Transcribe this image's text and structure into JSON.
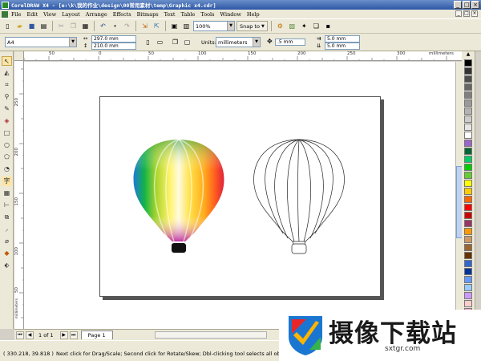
{
  "window": {
    "title": "CorelDRAW X4 - [e:\\k\\我的作业\\design\\00常用素材\\temp\\Graphic x4.cdr]",
    "controls": [
      "_",
      "□",
      "×"
    ]
  },
  "menu": {
    "items": [
      "File",
      "Edit",
      "View",
      "Layout",
      "Arrange",
      "Effects",
      "Bitmaps",
      "Text",
      "Table",
      "Tools",
      "Window",
      "Help"
    ],
    "mdi_controls": [
      "_",
      "□",
      "×"
    ]
  },
  "toolbar": {
    "zoom_value": "100%",
    "snap_label": "Snap to"
  },
  "property_bar": {
    "paper": "A4",
    "width": "297.0 mm",
    "height": "210.0 mm",
    "units_label": "Units:",
    "units_value": "millimeters",
    "nudge": ".5 mm",
    "dup_x": "5.0 mm",
    "dup_y": "5.0 mm"
  },
  "rulers": {
    "h_labels": [
      "100",
      "50",
      "0",
      "50",
      "100",
      "150",
      "200",
      "250",
      "300"
    ],
    "h_unit": "millimeters",
    "v_labels": [
      "250",
      "200",
      "150",
      "100",
      "50",
      "0"
    ],
    "v_unit": "millimeters"
  },
  "document": {
    "page_count": "1 of 1",
    "page_tab": "Page 1"
  },
  "status": {
    "coords": "( 330.218, 39.818 )",
    "hint": "Next click for Drag/Scale; Second click for Rotate/Skew; Dbl-clicking tool selects all objects; Shift+cli"
  },
  "palette": {
    "colors": [
      "#000000",
      "#333333",
      "#4d4d4d",
      "#666666",
      "#808080",
      "#999999",
      "#b3b3b3",
      "#cccccc",
      "#e6e6e6",
      "#ffffff",
      "#9966cc",
      "#006633",
      "#00cc66",
      "#00cc00",
      "#66cc33",
      "#ffff00",
      "#ffcc00",
      "#ff6600",
      "#ff0000",
      "#cc0000",
      "#993366",
      "#ff9900",
      "#cc9966",
      "#996633",
      "#663300",
      "#3366cc",
      "#003399",
      "#6699ff",
      "#99ccff",
      "#cc99ff",
      "#ffcccc",
      "#ff99cc"
    ]
  },
  "watermark": {
    "text": "摄像下载站",
    "url": "sxtgr.com"
  },
  "colors": {
    "title_bar": "#2d57a6",
    "chrome": "#ece9d8"
  }
}
